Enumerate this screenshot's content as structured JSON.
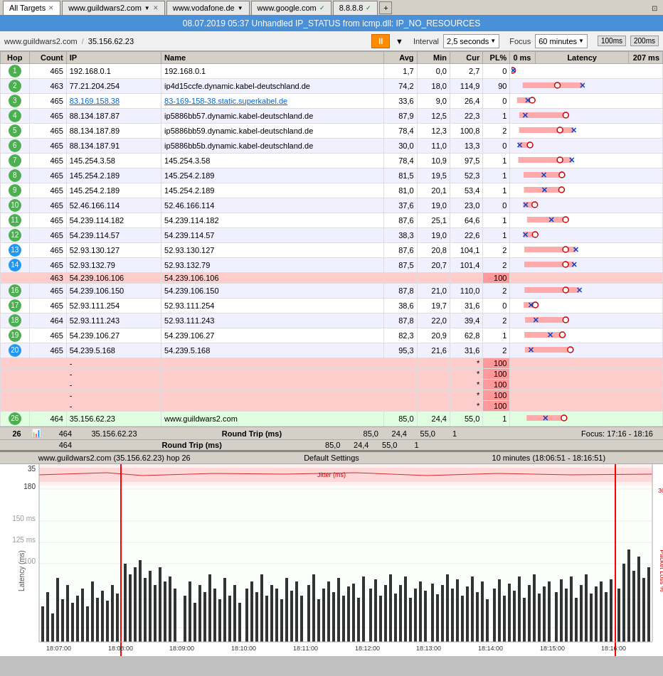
{
  "tabs": [
    {
      "label": "All Targets",
      "active": true,
      "closable": true
    },
    {
      "label": "www.guildwars2.com",
      "active": false,
      "closable": true,
      "dropdown": true
    },
    {
      "label": "www.vodafone.de",
      "active": false,
      "closable": false,
      "dropdown": true
    },
    {
      "label": "www.google.com",
      "active": false,
      "closable": false
    },
    {
      "label": "8.8.8.8",
      "active": false,
      "closable": false
    },
    {
      "label": "+",
      "add": true
    }
  ],
  "title_bar": "08.07.2019 05:37 Unhandled IP_STATUS from icmp.dll: IP_NO_RESOURCES",
  "address": {
    "domain": "www.guildwars2.com",
    "ip": "35.156.62.23"
  },
  "controls": {
    "pause_label": "⏸",
    "interval_label": "Interval",
    "interval_value": "2,5 seconds",
    "focus_label": "Focus",
    "focus_value": "60 minutes",
    "ms100": "100ms",
    "ms200": "200ms"
  },
  "table_headers": [
    "Hop",
    "Count",
    "IP",
    "Name",
    "Avg",
    "Min",
    "Cur",
    "PL%",
    "0 ms",
    "Latency",
    "207 ms"
  ],
  "rows": [
    {
      "hop": "1",
      "hop_color": "green",
      "count": "465",
      "ip": "192.168.0.1",
      "name": "192.168.0.1",
      "avg": "1,7",
      "min": "0,0",
      "cur": "2,7",
      "pl": "0",
      "bar_avg": 1,
      "bar_min": 0,
      "bar_cur": 2
    },
    {
      "hop": "2",
      "hop_color": "green",
      "count": "463",
      "ip": "77.21.204.254",
      "name": "ip4d15ccfe.dynamic.kabel-deutschland.de",
      "avg": "74,2",
      "min": "18,0",
      "cur": "114,9",
      "pl": "90",
      "bar_avg": 74,
      "bar_min": 18,
      "bar_cur": 115,
      "highlight": true
    },
    {
      "hop": "3",
      "hop_color": "green",
      "count": "465",
      "ip": "83.169.158.38",
      "name": "83-169-158-38.static.superkabel.de",
      "avg": "33,6",
      "min": "9,0",
      "cur": "26,4",
      "pl": "0",
      "bar_avg": 34,
      "bar_min": 9,
      "bar_cur": 26,
      "link_ip": true
    },
    {
      "hop": "4",
      "hop_color": "green",
      "count": "465",
      "ip": "88.134.187.87",
      "name": "ip5886bb57.dynamic.kabel-deutschland.de",
      "avg": "87,9",
      "min": "12,5",
      "cur": "22,3",
      "pl": "1"
    },
    {
      "hop": "5",
      "hop_color": "green",
      "count": "465",
      "ip": "88.134.187.89",
      "name": "ip5886bb59.dynamic.kabel-deutschland.de",
      "avg": "78,4",
      "min": "12,3",
      "cur": "100,8",
      "pl": "2"
    },
    {
      "hop": "6",
      "hop_color": "green",
      "count": "465",
      "ip": "88.134.187.91",
      "name": "ip5886bb5b.dynamic.kabel-deutschland.de",
      "avg": "30,0",
      "min": "11,0",
      "cur": "13,3",
      "pl": "0"
    },
    {
      "hop": "7",
      "hop_color": "green",
      "count": "465",
      "ip": "145.254.3.58",
      "name": "145.254.3.58",
      "avg": "78,4",
      "min": "10,9",
      "cur": "97,5",
      "pl": "1"
    },
    {
      "hop": "8",
      "hop_color": "green",
      "count": "465",
      "ip": "145.254.2.189",
      "name": "145.254.2.189",
      "avg": "81,5",
      "min": "19,5",
      "cur": "52,3",
      "pl": "1"
    },
    {
      "hop": "9",
      "hop_color": "green",
      "count": "465",
      "ip": "145.254.2.189",
      "name": "145.254.2.189",
      "avg": "81,0",
      "min": "20,1",
      "cur": "53,4",
      "pl": "1"
    },
    {
      "hop": "10",
      "hop_color": "green",
      "count": "465",
      "ip": "52.46.166.114",
      "name": "52.46.166.114",
      "avg": "37,6",
      "min": "19,0",
      "cur": "23,0",
      "pl": "0"
    },
    {
      "hop": "11",
      "hop_color": "green",
      "count": "465",
      "ip": "54.239.114.182",
      "name": "54.239.114.182",
      "avg": "87,6",
      "min": "25,1",
      "cur": "64,6",
      "pl": "1"
    },
    {
      "hop": "12",
      "hop_color": "green",
      "count": "465",
      "ip": "54.239.114.57",
      "name": "54.239.114.57",
      "avg": "38,3",
      "min": "19,0",
      "cur": "22,6",
      "pl": "1"
    },
    {
      "hop": "13",
      "hop_color": "blue",
      "count": "465",
      "ip": "52.93.130.127",
      "name": "52.93.130.127",
      "avg": "87,6",
      "min": "20,8",
      "cur": "104,1",
      "pl": "2"
    },
    {
      "hop": "14",
      "hop_color": "blue",
      "count": "465",
      "ip": "52.93.132.79",
      "name": "52.93.132.79",
      "avg": "87,5",
      "min": "20,7",
      "cur": "101,4",
      "pl": "2"
    },
    {
      "hop": "",
      "count": "463",
      "ip": "54.239.106.106",
      "name": "54.239.106.106",
      "avg": "",
      "min": "",
      "cur": "",
      "pl": "*",
      "pl_val": "100",
      "highlight_red": true
    },
    {
      "hop": "16",
      "hop_color": "green",
      "count": "465",
      "ip": "54.239.106.150",
      "name": "54.239.106.150",
      "avg": "87,8",
      "min": "21,0",
      "cur": "110,0",
      "pl": "2"
    },
    {
      "hop": "17",
      "hop_color": "green",
      "count": "465",
      "ip": "52.93.111.254",
      "name": "52.93.111.254",
      "avg": "38,6",
      "min": "19,7",
      "cur": "31,6",
      "pl": "0"
    },
    {
      "hop": "18",
      "hop_color": "green",
      "count": "464",
      "ip": "52.93.111.243",
      "name": "52.93.111.243",
      "avg": "87,8",
      "min": "22,0",
      "cur": "39,4",
      "pl": "2"
    },
    {
      "hop": "19",
      "hop_color": "green",
      "count": "465",
      "ip": "54.239.106.27",
      "name": "54.239.106.27",
      "avg": "82,3",
      "min": "20,9",
      "cur": "62,8",
      "pl": "1"
    },
    {
      "hop": "20",
      "hop_color": "blue",
      "count": "465",
      "ip": "54.239.5.168",
      "name": "54.239.5.168",
      "avg": "95,3",
      "min": "21,6",
      "cur": "31,6",
      "pl": "2"
    },
    {
      "hop": "",
      "count": "",
      "ip": "-",
      "name": "",
      "avg": "",
      "min": "",
      "cur": "*",
      "pl": "100",
      "highlight_red": true
    },
    {
      "hop": "",
      "count": "",
      "ip": "-",
      "name": "",
      "avg": "",
      "min": "",
      "cur": "*",
      "pl": "100",
      "highlight_red": true
    },
    {
      "hop": "",
      "count": "",
      "ip": "-",
      "name": "",
      "avg": "",
      "min": "",
      "cur": "*",
      "pl": "100",
      "highlight_red": true
    },
    {
      "hop": "",
      "count": "",
      "ip": "-",
      "name": "",
      "avg": "",
      "min": "",
      "cur": "*",
      "pl": "100",
      "highlight_red": true
    },
    {
      "hop": "",
      "count": "",
      "ip": "-",
      "name": "",
      "avg": "",
      "min": "",
      "cur": "*",
      "pl": "100",
      "highlight_red": true
    },
    {
      "hop": "26",
      "hop_color": "green",
      "count": "464",
      "ip": "35.156.62.23",
      "name": "www.guildwars2.com",
      "avg": "85,0",
      "min": "24,4",
      "cur": "55,0",
      "pl": "1",
      "is_last": true
    }
  ],
  "round_trip": {
    "label": "Round Trip (ms)",
    "count": "464",
    "avg": "85,0",
    "min": "24,4",
    "cur": "55,0",
    "pl": "1"
  },
  "focus_bar": {
    "label": "Focus: 17:16 - 18:16"
  },
  "chart_header": {
    "host": "www.guildwars2.com (35.156.62.23) hop 26",
    "settings": "Default Settings",
    "duration": "10 minutes (18:06:51 - 18:16:51)"
  },
  "chart_y_labels": [
    "35",
    "180",
    "150 ms",
    "125 ms",
    "100",
    "Latency (ms)"
  ],
  "chart_x_labels": [
    "18:07:00",
    "18:08:00",
    "18:09:00",
    "18:10:00",
    "18:11:00",
    "18:12:00",
    "18:13:00",
    "18:14:00",
    "18:15:00",
    "18:16:00"
  ],
  "chart_right_label": "30",
  "chart_right_label2": "Packet Loss %",
  "jitter_label": "Jitter (ms)"
}
